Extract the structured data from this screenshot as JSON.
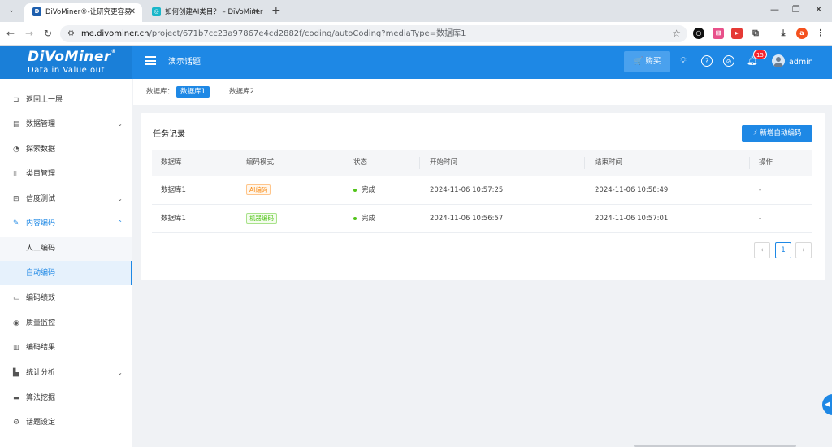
{
  "browser": {
    "tabs": [
      {
        "title": "DiVoMiner®-让研究更容易",
        "active": true
      },
      {
        "title": "如何创建AI类目？ – DiVoMiner",
        "active": false
      }
    ],
    "url_host": "me.divominer.cn",
    "url_path": "/project/671b7cc23a97867e4cd2882f/coding/autoCoding?mediaType=数据库1",
    "profile_initial": "a"
  },
  "header": {
    "brand": "DiVoMiner",
    "tagline": "Data in  Value out",
    "project_title": "演示话题",
    "buy_label": "购买",
    "notification_count": "15",
    "user": "admin"
  },
  "sidebar": {
    "items": [
      {
        "icon": "back-icon",
        "label": "返回上一层"
      },
      {
        "icon": "data-manage-icon",
        "label": "数据管理"
      },
      {
        "icon": "explore-icon",
        "label": "探索数据"
      },
      {
        "icon": "category-icon",
        "label": "类目管理"
      },
      {
        "icon": "reliability-icon",
        "label": "信度测试"
      },
      {
        "icon": "coding-icon",
        "label": "内容编码"
      },
      {
        "label": "人工编码"
      },
      {
        "label": "自动编码"
      },
      {
        "icon": "performance-icon",
        "label": "编码绩效"
      },
      {
        "icon": "eye-icon",
        "label": "质量监控"
      },
      {
        "icon": "result-icon",
        "label": "编码结果"
      },
      {
        "icon": "stats-icon",
        "label": "统计分析"
      },
      {
        "icon": "algo-icon",
        "label": "算法挖掘"
      },
      {
        "icon": "settings-icon",
        "label": "话题设定"
      }
    ]
  },
  "db_bar": {
    "label": "数据库：",
    "databases": [
      "数据库1",
      "数据库2"
    ],
    "active": "数据库1"
  },
  "task_card": {
    "title": "任务记录",
    "new_button": "新增自动编码",
    "columns": [
      "数据库",
      "编码模式",
      "状态",
      "开始时间",
      "结束时间",
      "操作"
    ],
    "rows": [
      {
        "db": "数据库1",
        "mode": "AI编码",
        "mode_type": "ai",
        "status": "完成",
        "start": "2024-11-06 10:57:25",
        "end": "2024-11-06 10:58:49",
        "action": "-"
      },
      {
        "db": "数据库1",
        "mode": "机器编码",
        "mode_type": "machine",
        "status": "完成",
        "start": "2024-11-06 10:56:57",
        "end": "2024-11-06 10:57:01",
        "action": "-"
      }
    ],
    "pagination": {
      "prev": "‹",
      "current": "1",
      "next": "›"
    }
  },
  "colors": {
    "primary": "#1e88e5",
    "success": "#52c41a",
    "ai_tag": "#fa8c16"
  }
}
